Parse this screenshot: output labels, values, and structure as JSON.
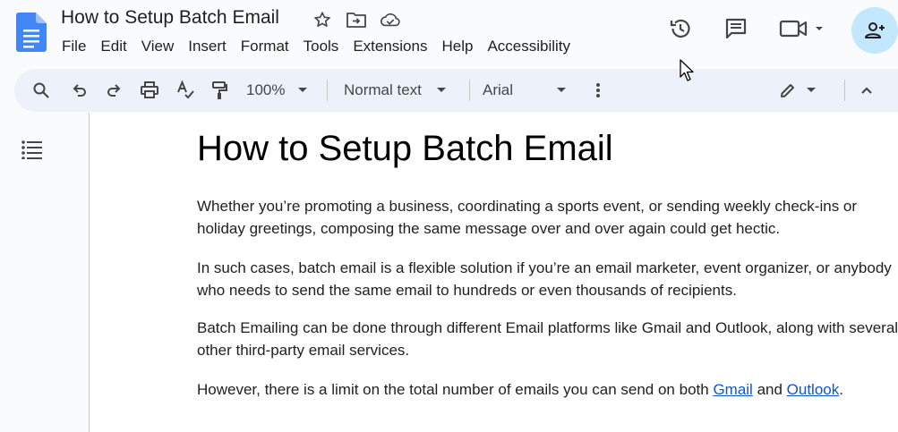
{
  "header": {
    "title": "How to Setup Batch Email",
    "menus": [
      "File",
      "Edit",
      "View",
      "Insert",
      "Format",
      "Tools",
      "Extensions",
      "Help",
      "Accessibility"
    ]
  },
  "toolbar": {
    "zoom": "100%",
    "style": "Normal text",
    "font": "Arial"
  },
  "document": {
    "heading": "How to Setup Batch Email",
    "paragraphs": [
      "Whether you’re promoting a business, coordinating a sports event, or sending weekly check-ins or holiday greetings, composing the same message over and over again could get hectic.",
      "In such cases, batch email is a flexible solution if you’re an email marketer, event organizer, or anybody who needs to send the same email to hundreds or even thousands of recipients.",
      "Batch Emailing can be done through different Email platforms like Gmail and Outlook, along with several other third-party email services."
    ],
    "last_paragraph": {
      "prefix": "However, there is a limit on the total number of emails you can send on both ",
      "link1": "Gmail",
      "middle": " and ",
      "link2": "Outlook",
      "suffix": "."
    }
  },
  "colors": {
    "brand_blue": "#4285f4",
    "link": "#1155cc",
    "share_bg": "#c2e7ff",
    "toolbar_bg": "#edf2fa"
  },
  "icons": {
    "title": [
      "star-icon",
      "move-folder-icon",
      "cloud-saved-icon"
    ],
    "right": [
      "history-icon",
      "comments-icon",
      "meet-icon",
      "share-person-add-icon"
    ],
    "toolbar": [
      "search-icon",
      "undo-icon",
      "redo-icon",
      "print-icon",
      "spellcheck-icon",
      "paint-format-icon",
      "more-vert-icon",
      "edit-pencil-icon",
      "collapse-chevron-icon"
    ]
  }
}
